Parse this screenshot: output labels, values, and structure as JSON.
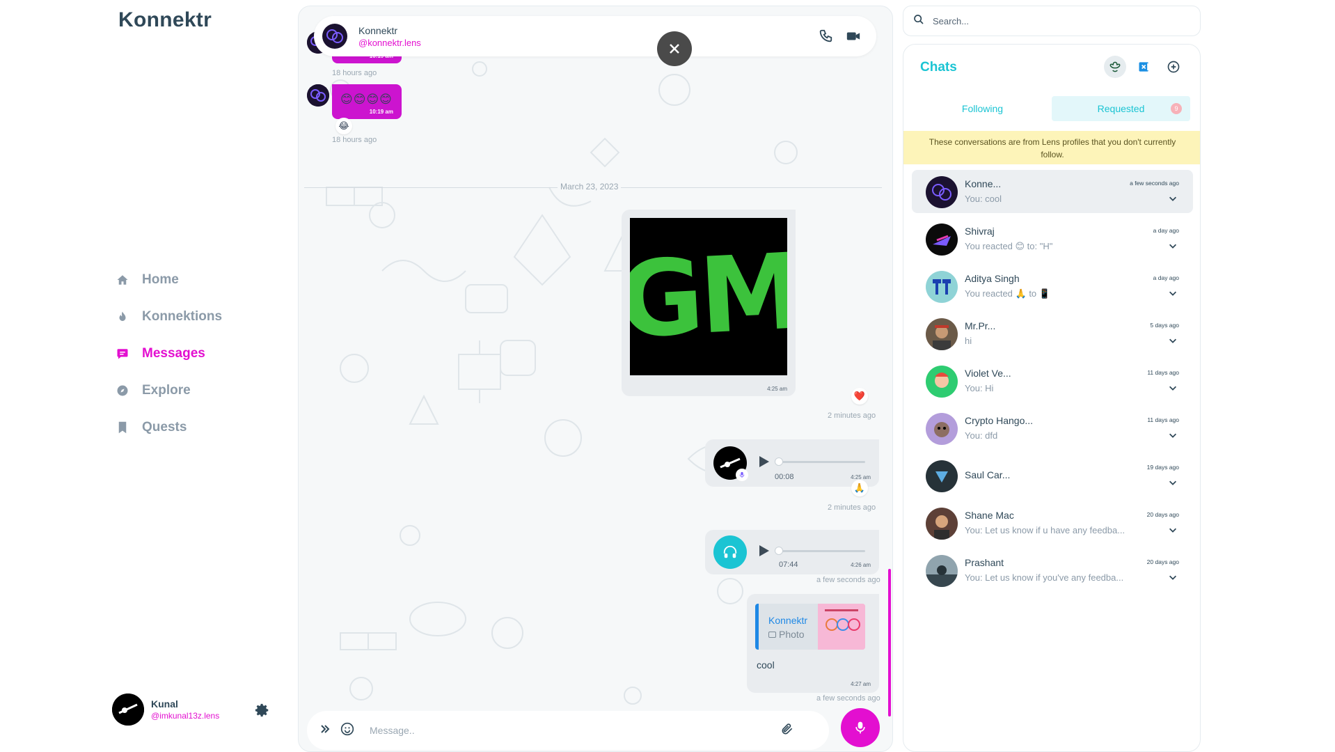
{
  "brand": "Konnektr",
  "nav": {
    "items": [
      {
        "label": "Home",
        "icon": "home-icon"
      },
      {
        "label": "Konnektions",
        "icon": "flame-icon"
      },
      {
        "label": "Messages",
        "icon": "message-icon"
      },
      {
        "label": "Explore",
        "icon": "compass-icon"
      },
      {
        "label": "Quests",
        "icon": "bookmark-icon"
      }
    ],
    "active": "Messages",
    "active_color": "#e30fd0"
  },
  "profile": {
    "name": "Kunal",
    "handle": "@imkunal13z.lens"
  },
  "chat": {
    "header": {
      "name": "Konnektr",
      "handle": "@konnektr.lens"
    },
    "messages": {
      "m1": {
        "emojis": "😊😊😊😊",
        "time": "10:19 am",
        "ago": "18 hours ago"
      },
      "m2": {
        "emojis": "😊😊😊😊",
        "time": "10:19 am",
        "reaction": "😂",
        "ago": "18 hours ago"
      },
      "date": "March 23, 2023",
      "image": {
        "image_text": "GM",
        "time": "4:25 am",
        "reaction": "❤️",
        "ago": "2 minutes ago"
      },
      "voice": {
        "duration": "00:08",
        "time": "4:25 am",
        "reaction": "🙏",
        "ago": "2 minutes ago"
      },
      "audio": {
        "duration": "07:44",
        "time": "4:26 am",
        "ago": "a few seconds ago"
      },
      "reply": {
        "reply_name": "Konnektr",
        "reply_type": "Photo",
        "text": "cool",
        "time": "4:27 am",
        "ago": "a few seconds ago"
      }
    },
    "composer": {
      "placeholder": "Message.."
    }
  },
  "search": {
    "placeholder": "Search..."
  },
  "chats": {
    "title": "Chats",
    "tabs": [
      {
        "label": "Following"
      },
      {
        "label": "Requested",
        "badge": "9"
      }
    ],
    "active_tab": "Requested",
    "notice": "These conversations are from Lens profiles that you don't currently follow.",
    "conversations": [
      {
        "name": "Konne...",
        "preview": "You: cool",
        "time": "a few seconds ago"
      },
      {
        "name": "Shivraj",
        "preview": "You reacted 😊 to: \"H\"",
        "time": "a day ago"
      },
      {
        "name": "Aditya Singh",
        "preview": "You reacted 🙏 to 📱",
        "time": "a day ago"
      },
      {
        "name": "Mr.Pr...",
        "preview": "hi",
        "time": "5 days ago"
      },
      {
        "name": "Violet Ve...",
        "preview": "You: Hi",
        "time": "11 days ago"
      },
      {
        "name": "Crypto Hango...",
        "preview": "You: dfd",
        "time": "11 days ago"
      },
      {
        "name": "Saul Car...",
        "preview": "",
        "time": "19 days ago"
      },
      {
        "name": "Shane Mac",
        "preview": "You: Let us know if u have any feedba...",
        "time": "20 days ago"
      },
      {
        "name": "Prashant",
        "preview": "You: Let us know if you've any feedba...",
        "time": "20 days ago"
      }
    ]
  },
  "colors": {
    "accent": "#e30fd0",
    "teal": "#1bc4d3",
    "bubble": "#cc14cf"
  }
}
